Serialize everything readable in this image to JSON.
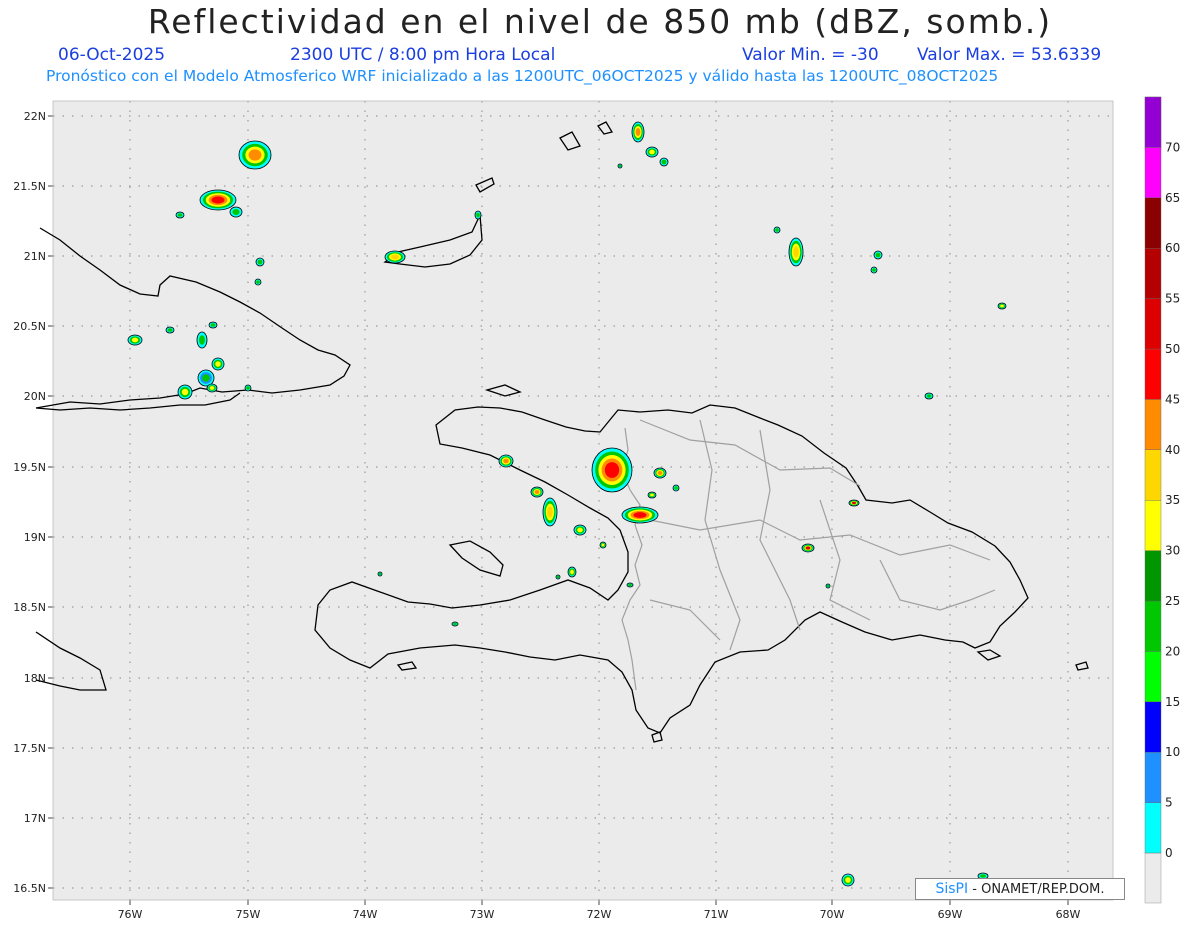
{
  "header": {
    "title": "Reflectividad en el nivel de 850 mb (dBZ, somb.)",
    "date": "06-Oct-2025",
    "time": "2300 UTC / 8:00 pm Hora Local",
    "valor_min": "Valor Min. = -30",
    "valor_max": "Valor Max. = 53.6339",
    "model_line": "Pronóstico con el Modelo Atmosferico WRF inicializado a las 1200UTC_06OCT2025 y válido hasta las  1200UTC_08OCT2025"
  },
  "map": {
    "lat_labels": [
      "22N",
      "21.5N",
      "21N",
      "20.5N",
      "20N",
      "19.5N",
      "19N",
      "18.5N",
      "18N",
      "17.5N",
      "17N",
      "16.5N"
    ],
    "lon_labels": [
      "76W",
      "75W",
      "74W",
      "73W",
      "72W",
      "71W",
      "70W",
      "69W",
      "68W"
    ],
    "background_color": "#ebebeb",
    "coast_color": "#000000",
    "border_color": "#a0a0a0"
  },
  "colorbar": {
    "levels": [
      {
        "label": "0",
        "color": "#00ffff"
      },
      {
        "label": "5",
        "color": "#1e90ff"
      },
      {
        "label": "10",
        "color": "#0000ff"
      },
      {
        "label": "15",
        "color": "#00ff00"
      },
      {
        "label": "20",
        "color": "#00c800"
      },
      {
        "label": "25",
        "color": "#009600"
      },
      {
        "label": "30",
        "color": "#ffff00"
      },
      {
        "label": "35",
        "color": "#ffd700"
      },
      {
        "label": "40",
        "color": "#ff8c00"
      },
      {
        "label": "45",
        "color": "#ff0000"
      },
      {
        "label": "50",
        "color": "#dc0000"
      },
      {
        "label": "55",
        "color": "#b40000"
      },
      {
        "label": "60",
        "color": "#8b0000"
      },
      {
        "label": "65",
        "color": "#ff00ff"
      },
      {
        "label": "70",
        "color": "#9400d3"
      }
    ]
  },
  "credit": {
    "logo": "SisPI",
    "text": "- ONAMET/REP.DOM."
  }
}
